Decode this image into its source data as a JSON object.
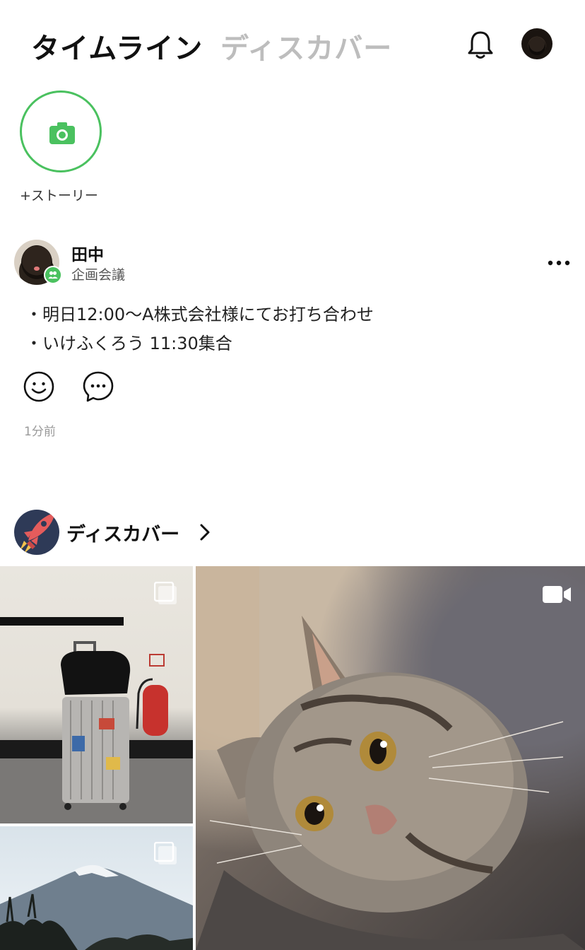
{
  "header": {
    "tab_timeline": "タイムライン",
    "tab_discover": "ディスカバー"
  },
  "stories": {
    "add_label": "+ストーリー"
  },
  "post": {
    "author": "田中",
    "group": "企画会議",
    "lines": [
      "・明日12:00〜A株式会社様にてお打ち合わせ",
      "・いけふくろう 11:30集合"
    ],
    "time": "1分前"
  },
  "discover": {
    "title": "ディスカバー"
  },
  "colors": {
    "accent_green": "#4ac15f",
    "inactive_tab": "#bdbdbd",
    "rocket_bg": "#2e3a57"
  },
  "icons": {
    "notification": "bell-icon",
    "story_add": "camera-icon",
    "more": "more-dots-icon",
    "react": "smiley-icon",
    "comment": "comment-icon",
    "discover_avatar": "rocket-icon",
    "multi_image": "multi-image-icon",
    "video": "video-icon"
  }
}
